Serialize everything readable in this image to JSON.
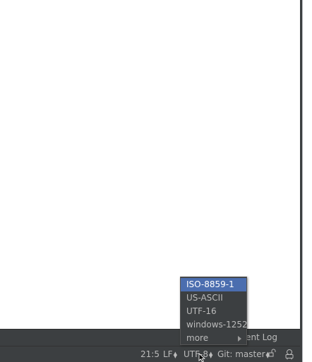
{
  "tool_window_bar": {
    "event_log_label": "Event Log"
  },
  "status_bar": {
    "caret_position": "21:5",
    "line_separator": "LF",
    "encoding": "UTF-8",
    "vcs_branch": "Git: master",
    "icons": [
      "lock-icon",
      "hector-inspector-icon"
    ]
  },
  "encoding_popup": {
    "items": [
      {
        "label": "ISO-8859-1",
        "selected": true
      },
      {
        "label": "US-ASCII",
        "selected": false
      },
      {
        "label": "UTF-16",
        "selected": false
      },
      {
        "label": "windows-1252",
        "selected": false
      },
      {
        "label": "more",
        "selected": false,
        "has_submenu": true
      }
    ]
  },
  "colors": {
    "panel_bg": "#3c3f41",
    "selection": "#4b6eaf",
    "text": "#bbbbbb",
    "editor_bg": "#ffffff"
  }
}
